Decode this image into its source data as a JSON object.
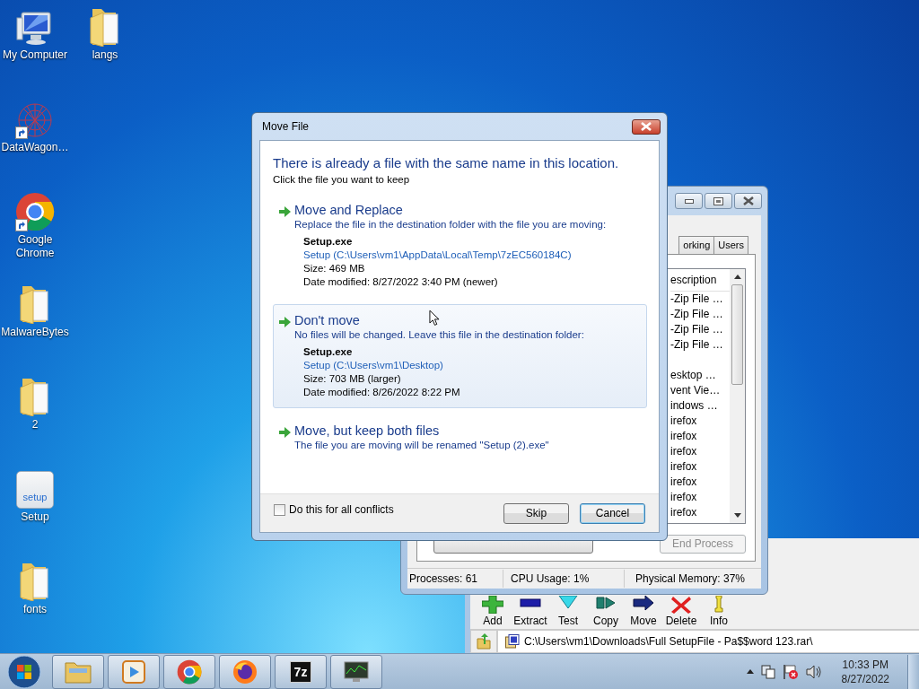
{
  "desktop_icons": [
    {
      "label": "My Computer",
      "kind": "computer",
      "shortcut": false
    },
    {
      "label": "DataWagon…",
      "kind": "network",
      "shortcut": true
    },
    {
      "label": "Google Chrome",
      "kind": "chrome",
      "shortcut": true
    },
    {
      "label": "MalwareBytes",
      "kind": "folder",
      "shortcut": false
    },
    {
      "label": "2",
      "kind": "folder",
      "shortcut": false
    },
    {
      "label": "Setup",
      "kind": "setup",
      "shortcut": false,
      "icon_text": "setup"
    },
    {
      "label": "fonts",
      "kind": "folder",
      "shortcut": false
    },
    {
      "label": "langs",
      "kind": "folder",
      "shortcut": false
    }
  ],
  "task_manager": {
    "tabs": [
      {
        "label": "orking",
        "selected": false
      },
      {
        "label": "Users",
        "selected": false
      }
    ],
    "column_heading": "escription",
    "rows": [
      {
        "kind": "text",
        "text": "-Zip File …"
      },
      {
        "kind": "text",
        "text": "-Zip File …"
      },
      {
        "kind": "text",
        "text": "-Zip File …"
      },
      {
        "kind": "text",
        "text": "-Zip File …"
      },
      {
        "kind": "blank"
      },
      {
        "kind": "text",
        "text": "esktop …"
      },
      {
        "kind": "text",
        "text": "vent Vie…"
      },
      {
        "kind": "text",
        "text": "indows …"
      },
      {
        "kind": "text",
        "text": "irefox"
      },
      {
        "kind": "text",
        "text": "irefox"
      },
      {
        "kind": "text",
        "text": "irefox"
      },
      {
        "kind": "text",
        "text": "irefox"
      },
      {
        "kind": "text",
        "text": "irefox"
      },
      {
        "kind": "text",
        "text": "irefox"
      },
      {
        "kind": "text",
        "text": "irefox"
      }
    ],
    "end_process": {
      "label": "End Process",
      "disabled": true
    },
    "status_bar": [
      "Processes: 61",
      "CPU Usage: 1%",
      "Physical Memory: 37%"
    ]
  },
  "archiver": {
    "toolbar": [
      {
        "label": "Add",
        "kind": "add"
      },
      {
        "label": "Extract",
        "kind": "extract"
      },
      {
        "label": "Test",
        "kind": "test"
      },
      {
        "label": "Copy",
        "kind": "copy"
      },
      {
        "label": "Move",
        "kind": "move"
      },
      {
        "label": "Delete",
        "kind": "delete"
      },
      {
        "label": "Info",
        "kind": "info"
      }
    ],
    "path": "C:\\Users\\vm1\\Downloads\\Full SetupFile - Pa$$word 123.rar\\"
  },
  "move_dialog": {
    "title": "Move File",
    "heading": "There is already a file with the same name in this location.",
    "instruction": "Click the file you want to keep",
    "options": [
      {
        "title": "Move and Replace",
        "description": "Replace the file in the destination folder with the file you are moving:",
        "highlighted": false,
        "file": {
          "name": "Setup.exe",
          "location": "Setup (C:\\Users\\vm1\\AppData\\Local\\Temp\\7zEC560184C)",
          "size": "Size: 469 MB",
          "modified": "Date modified: 8/27/2022 3:40 PM (newer)"
        }
      },
      {
        "title": "Don't move",
        "description": "No files will be changed. Leave this file in the destination folder:",
        "highlighted": true,
        "file": {
          "name": "Setup.exe",
          "location": "Setup (C:\\Users\\vm1\\Desktop)",
          "size": "Size: 703 MB (larger)",
          "modified": "Date modified: 8/26/2022 8:22 PM"
        }
      },
      {
        "title": "Move, but keep both files",
        "description": "The file you are moving will be renamed \"Setup (2).exe\"",
        "highlighted": false
      }
    ],
    "apply_all": {
      "label": "Do this for all conflicts",
      "checked": false
    },
    "buttons": [
      {
        "label": "Skip",
        "focused": false
      },
      {
        "label": "Cancel",
        "focused": true
      }
    ]
  },
  "taskbar": {
    "apps": [
      {
        "kind": "explorer"
      },
      {
        "kind": "media"
      },
      {
        "kind": "chrome"
      },
      {
        "kind": "firefox"
      },
      {
        "kind": "sevenzip",
        "label": "7z"
      },
      {
        "kind": "monitor"
      }
    ],
    "clock": {
      "time": "10:33 PM",
      "date": "8/27/2022"
    }
  }
}
